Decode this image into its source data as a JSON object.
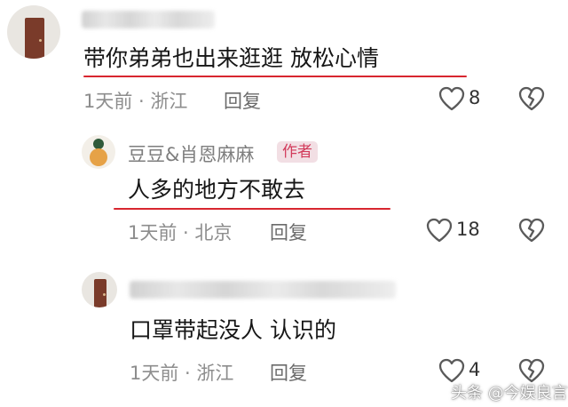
{
  "comments": [
    {
      "text": "带你弟弟也出来逛逛 放松心情",
      "location": "1天前 · 浙江",
      "reply_label": "回复",
      "like_count": "8"
    },
    {
      "author": "豆豆&肖恩麻麻",
      "author_badge": "作者",
      "text": "人多的地方不敢去",
      "location": "1天前 · 北京",
      "reply_label": "回复",
      "like_count": "18"
    },
    {
      "text": "口罩带起没人 认识的",
      "location": "1天前 · 浙江",
      "reply_label": "回复",
      "like_count": "4"
    }
  ],
  "watermark": "头条 @今娱良言",
  "colors": {
    "underline": "#d8262f",
    "badge_bg": "#f2dfe4",
    "badge_text": "#d23b5b"
  },
  "icons": [
    "like-icon",
    "dislike-icon",
    "avatar"
  ]
}
